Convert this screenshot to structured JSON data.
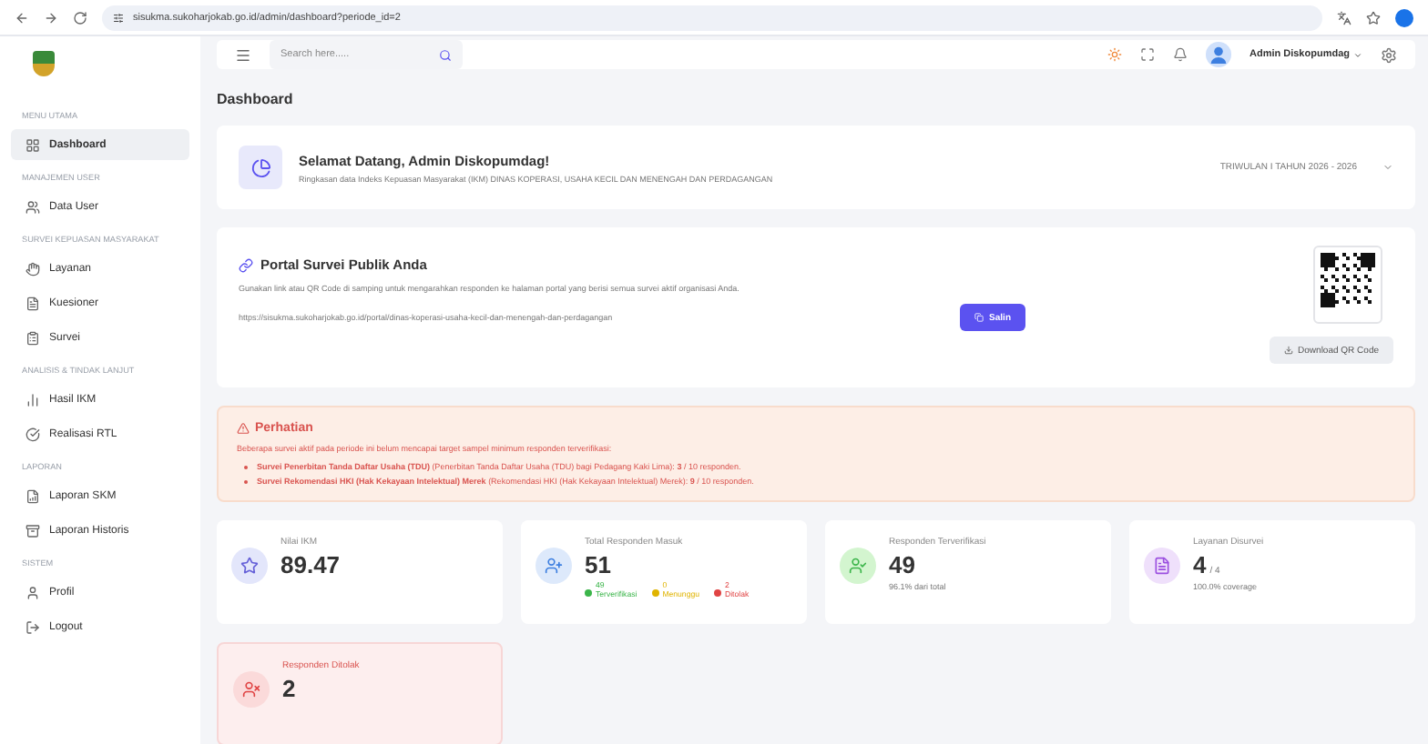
{
  "browser": {
    "url": "sisukma.sukoharjokab.go.id/admin/dashboard?periode_id=2"
  },
  "sidebar": {
    "sections": [
      {
        "title": "MENU UTAMA",
        "items": [
          {
            "label": "Dashboard",
            "selected": true
          }
        ]
      },
      {
        "title": "MANAJEMEN USER",
        "items": [
          {
            "label": "Data User",
            "selected": false
          }
        ]
      },
      {
        "title": "SURVEI KEPUASAN MASYARAKAT",
        "items": [
          {
            "label": "Layanan",
            "selected": false
          },
          {
            "label": "Kuesioner",
            "selected": false
          },
          {
            "label": "Survei",
            "selected": false
          }
        ]
      },
      {
        "title": "ANALISIS & TINDAK LANJUT",
        "items": [
          {
            "label": "Hasil IKM",
            "selected": false
          },
          {
            "label": "Realisasi RTL",
            "selected": false
          }
        ]
      },
      {
        "title": "LAPORAN",
        "items": [
          {
            "label": "Laporan SKM",
            "selected": false
          },
          {
            "label": "Laporan Historis",
            "selected": false
          }
        ]
      },
      {
        "title": "SISTEM",
        "items": [
          {
            "label": "Profil",
            "selected": false
          },
          {
            "label": "Logout",
            "selected": false
          }
        ]
      }
    ]
  },
  "topbar": {
    "search_placeholder": "Search here.....",
    "user": "Admin Diskopumdag"
  },
  "page_title": "Dashboard",
  "welcome": {
    "title": "Selamat Datang, Admin Diskopumdag!",
    "subtitle": "Ringkasan data Indeks Kepuasan Masyarakat (IKM) DINAS KOPERASI, USAHA KECIL DAN MENENGAH DAN PERDAGANGAN",
    "period": "TRIWULAN I TAHUN 2026 - 2026"
  },
  "portal": {
    "title": "Portal Survei Publik Anda",
    "description": "Gunakan link atau QR Code di samping untuk mengarahkan responden ke halaman portal yang berisi semua survei aktif organisasi Anda.",
    "link": "https://sisukma.sukoharjokab.go.id/portal/dinas-koperasi-usaha-kecil-dan-menengah-dan-perdagangan",
    "copy_button": "Salin",
    "download_button": "Download QR Code"
  },
  "alert": {
    "title": "Perhatian",
    "message": "Beberapa survei aktif pada periode ini belum mencapai target sampel minimum responden terverifikasi:",
    "items": [
      "**Survei Penerbitan Tanda Daftar Usaha (TDU)** (Penerbitan Tanda Daftar Usaha (TDU) bagi Pedagang Kaki Lima): **3** / 10 responden.",
      "**Survei Rekomendasi HKI (Hak Kekayaan Intelektual) Merek** (Rekomendasi HKI (Hak Kekayaan Intelektual) Merek): **9** / 10 responden."
    ]
  },
  "stats": [
    {
      "kind": "plain",
      "label": "Nilai IKM",
      "value": "89.47",
      "color": "#e3e6fb"
    },
    {
      "kind": "breakdown",
      "label": "Total Responden Masuk",
      "value": "51",
      "color": "#dde9fb",
      "parts": [
        {
          "count": "49",
          "label": "Terverifikasi",
          "color": "#3bb54a"
        },
        {
          "count": "0",
          "label": "Menunggu",
          "color": "#e0b400"
        },
        {
          "count": "2",
          "label": "Ditolak",
          "color": "#e04444"
        }
      ]
    },
    {
      "kind": "note",
      "label": "Responden Terverifikasi",
      "value": "49",
      "color": "#d3f5cf",
      "note": "96.1% dari total"
    },
    {
      "kind": "fraction",
      "label": "Layanan Disurvei",
      "value": "4",
      "suffix": "/ 4",
      "color": "#efe0fb",
      "note": "100.0% coverage"
    },
    {
      "kind": "danger",
      "label": "Responden Ditolak",
      "value": "2",
      "color": "#fbdada"
    }
  ]
}
